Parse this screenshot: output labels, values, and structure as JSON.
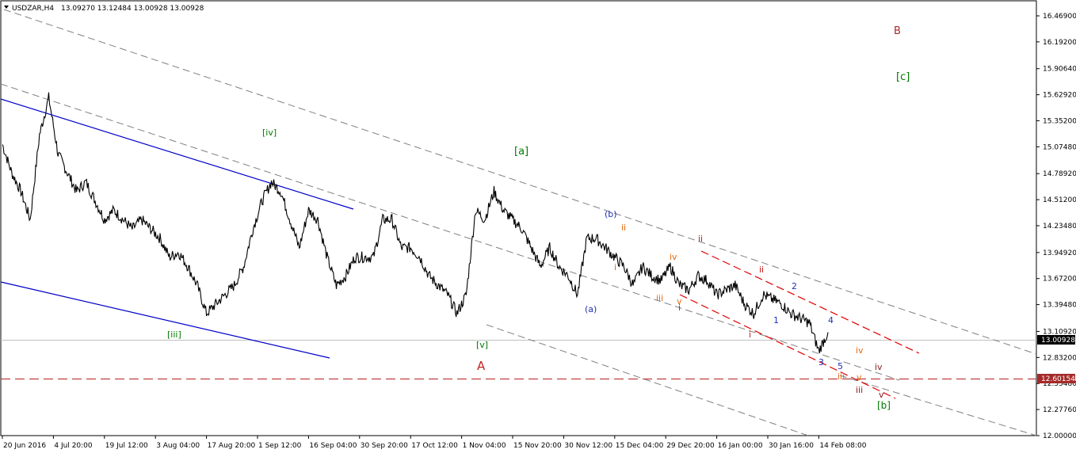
{
  "header": {
    "symbol": "USDZAR,H4",
    "ohlc": "13.09270 13.12484 13.00928 13.00928",
    "menu_icon": "triangle-down-icon"
  },
  "colors": {
    "price": "#000000",
    "channel_gray": "#808080",
    "channel_blue": "#0000c8",
    "channel_red": "#e00000",
    "wave_green": "#007a00",
    "wave_red": "#c02020",
    "wave_orange": "#e06a10",
    "wave_blue": "#2030b0",
    "wave_darkred": "#8b1a1a"
  },
  "chart_data": {
    "type": "line",
    "x_ticks": [
      "20 Jun 2016",
      "4 Jul 20:00",
      "19 Jul 12:00",
      "3 Aug 04:00",
      "17 Aug 20:00",
      "1 Sep 12:00",
      "16 Sep 04:00",
      "30 Sep 20:00",
      "17 Oct 12:00",
      "1 Nov 04:00",
      "15 Nov 20:00",
      "30 Nov 12:00",
      "15 Dec 04:00",
      "29 Dec 20:00",
      "16 Jan 00:00",
      "30 Jan 16:00",
      "14 Feb 08:00"
    ],
    "y_ticks": [
      "16.46900",
      "16.19200",
      "15.90640",
      "15.62920",
      "15.35200",
      "15.07480",
      "14.78920",
      "14.51200",
      "14.23480",
      "13.94920",
      "13.67200",
      "13.39480",
      "13.10920",
      "12.83200",
      "12.55480",
      "12.27760",
      "12.00000"
    ],
    "ylim": [
      12.0,
      16.469
    ],
    "current_price": "13.00928",
    "level_line": "12.60154",
    "series": [
      {
        "values": [
          15.1,
          14.8,
          14.6,
          14.3,
          15.2,
          15.6,
          15.0,
          14.8,
          14.6,
          14.7,
          14.5,
          14.3,
          14.4,
          14.3,
          14.2,
          14.3,
          14.2,
          14.1,
          13.9,
          13.95,
          13.8,
          13.6,
          13.3,
          13.4,
          13.5,
          13.6,
          13.8,
          14.2,
          14.5,
          14.7,
          14.6,
          14.3,
          14.0,
          14.4,
          14.3,
          13.9,
          13.6,
          13.7,
          13.9,
          13.9,
          13.9,
          14.3,
          14.3,
          14.0,
          14.0,
          13.9,
          13.7,
          13.6,
          13.5,
          13.3,
          13.5,
          14.4,
          14.3,
          14.6,
          14.4,
          14.3,
          14.2,
          14.0,
          13.8,
          14.0,
          13.8,
          13.7,
          13.5,
          14.1,
          14.1,
          14.0,
          13.9,
          13.8,
          13.6,
          13.8,
          13.7,
          13.65,
          13.8,
          13.6,
          13.55,
          13.7,
          13.65,
          13.5,
          13.55,
          13.6,
          13.4,
          13.3,
          13.5,
          13.45,
          13.4,
          13.3,
          13.25,
          13.2,
          12.9,
          13.1
        ]
      }
    ]
  },
  "wave_labels": {
    "iv_bracket": "[iv]",
    "a_bracket": "[a]",
    "b_letter": "B",
    "c_bracket": "[c]",
    "iii_bracket": "[iii]",
    "v_bracket": "[v]",
    "a_letter": "A",
    "a_paren": "(a)",
    "b_paren": "(b)",
    "i1": "i",
    "ii1": "ii",
    "iii1": "iii",
    "iv1": "iv",
    "v1": "v",
    "i2": "i",
    "ii2": "ii",
    "i3": "i",
    "ii3": "ii",
    "n1": "1",
    "n2": "2",
    "n3": "3",
    "n4": "4",
    "n5": "5",
    "iii2": "iii",
    "v2": "v",
    "iv2": "iv",
    "iii3": "iii",
    "iv3": "iv",
    "v3": "v",
    "b_bracket": "[b]"
  }
}
